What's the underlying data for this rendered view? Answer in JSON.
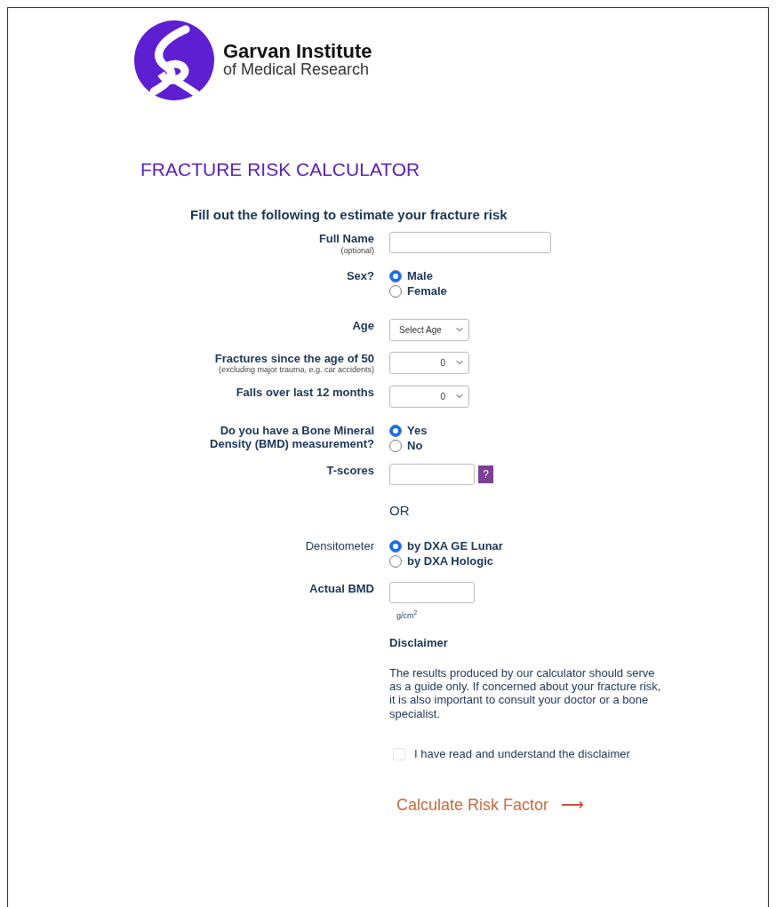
{
  "logo": {
    "line1": "Garvan Institute",
    "line2": "of Medical Research"
  },
  "title": "FRACTURE RISK CALCULATOR",
  "form_heading": "Fill out the following to estimate your fracture risk",
  "fields": [
    {
      "kind": "text",
      "label": "Full Name",
      "bold_label": true,
      "note": "(optional)"
    },
    {
      "kind": "radio",
      "label": "Sex?",
      "bold_label": true,
      "options": [
        {
          "label": "Male",
          "selected": true
        },
        {
          "label": "Female",
          "selected": false
        }
      ]
    },
    {
      "kind": "select",
      "label": "Age",
      "bold_label": true,
      "value": "Select Age"
    },
    {
      "kind": "select",
      "label": "Fractures since the age of 50",
      "bold_label": true,
      "note": "(excluding major trauma, e.g. car accidents)",
      "value": "0"
    },
    {
      "kind": "select",
      "label": "Falls over last 12 months",
      "bold_label": true,
      "value": "0"
    },
    {
      "kind": "radio",
      "label": "Do you have a Bone Mineral Density (BMD) measurement?",
      "bold_label": true,
      "options": [
        {
          "label": "Yes",
          "selected": true
        },
        {
          "label": "No",
          "selected": false
        }
      ]
    },
    {
      "kind": "number",
      "label": "T-scores",
      "bold_label": true,
      "help": "?"
    },
    {
      "kind": "separator",
      "text": "OR"
    },
    {
      "kind": "radio",
      "label": "Densitometer",
      "bold_label": false,
      "options": [
        {
          "label": "by DXA GE Lunar",
          "selected": true
        },
        {
          "label": "by DXA Hologic",
          "selected": false
        }
      ]
    },
    {
      "kind": "number",
      "label": "Actual BMD",
      "bold_label": true,
      "unit": "g/cm$^{2}$"
    }
  ],
  "disclaimer": {
    "heading": "Disclaimer",
    "text": "The results produced by our calculator should serve as a guide only. If concerned about your fracture risk, it is also important to consult your doctor or a bone specialist.",
    "checkbox": {
      "label": "I have read and understand the disclaimer",
      "checked": false
    }
  },
  "submit": {
    "label": "Calculate Risk Factor",
    "arrow": "⟶"
  }
}
